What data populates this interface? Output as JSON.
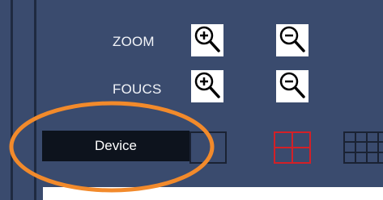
{
  "controls": {
    "zoom_label": "ZOOM",
    "focus_label": "FOUCS",
    "zoom_in_icon": "zoom-in-icon",
    "zoom_out_icon": "zoom-out-icon",
    "focus_in_icon": "zoom-in-icon",
    "focus_out_icon": "zoom-out-icon"
  },
  "device": {
    "label": "Device"
  },
  "layouts": {
    "options": [
      "single-layout-icon",
      "quad-layout-icon",
      "grid-9-layout-icon"
    ],
    "selected": "quad-layout-icon"
  },
  "colors": {
    "panel_bg": "#3a4b6e",
    "button_dark": "#0d131d",
    "selected_layout": "#d32027",
    "highlight": "#f28a2b"
  }
}
